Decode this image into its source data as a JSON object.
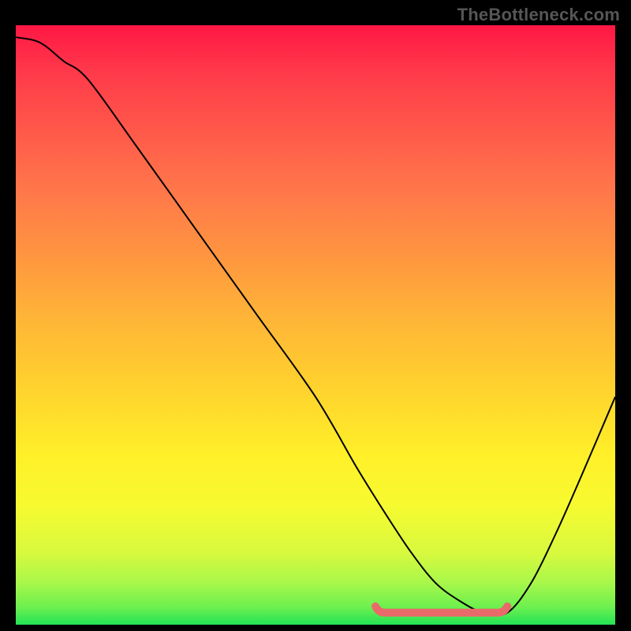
{
  "watermark": "TheBottleneck.com",
  "colors": {
    "background": "#000000",
    "watermark": "#565656",
    "curve_stroke": "#000000",
    "valley_stroke": "#e96a6a",
    "gradient_top": "#ff1744",
    "gradient_bottom": "#24e356"
  },
  "chart_data": {
    "type": "line",
    "title": "",
    "xlabel": "",
    "ylabel": "",
    "xlim": [
      0,
      100
    ],
    "ylim": [
      0,
      100
    ],
    "series": [
      {
        "name": "bottleneck-curve",
        "x": [
          0,
          3,
          5,
          8,
          12,
          20,
          30,
          40,
          50,
          57,
          62,
          66,
          70,
          74,
          78,
          82,
          86,
          90,
          94,
          100
        ],
        "values": [
          98,
          97.5,
          96.5,
          94,
          91,
          80,
          66,
          52,
          38,
          26,
          18,
          12,
          7,
          4,
          2,
          2,
          7,
          15,
          24,
          38
        ]
      }
    ],
    "valley_highlight": {
      "x_start": 60,
      "x_end": 82,
      "y": 2
    }
  }
}
